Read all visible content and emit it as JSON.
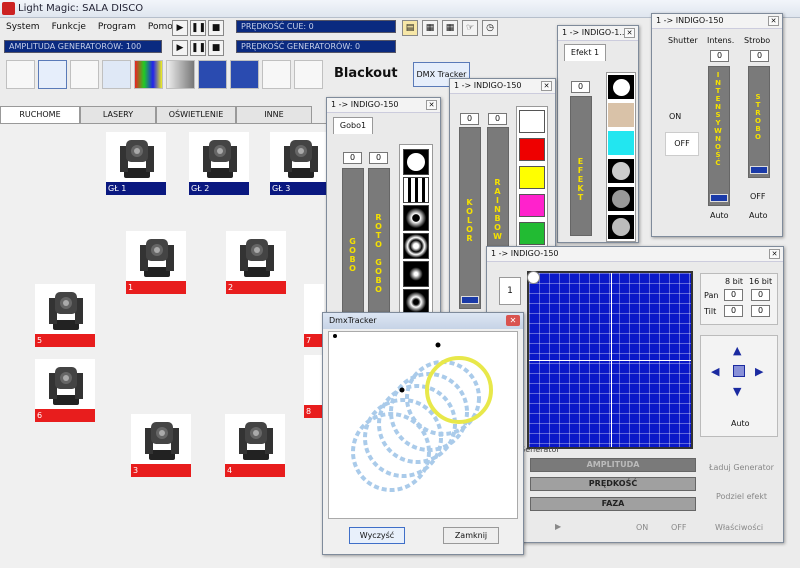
{
  "window": {
    "title": "Light Magic: SALA DISCO"
  },
  "menu": [
    "System",
    "Funkcje",
    "Program",
    "Pomoc"
  ],
  "toolbar": {
    "speed_label": "PRĘDKOŚĆ",
    "cue_label": "CUE: 0",
    "amp_label": "AMPLITUDA GENERATORÓW: 100",
    "gen_speed_label": "PRĘDKOŚĆ GENERATORÓW: 0",
    "blackout": "Blackout",
    "dmx_tracker": "DMX Tracker"
  },
  "tabs": [
    "RUCHOME GŁOWY",
    "LASERY",
    "OŚWIETLENIE LED",
    "INNE"
  ],
  "fixtures": {
    "top": [
      "GŁ 1",
      "GŁ 2",
      "GŁ 3"
    ],
    "rows": [
      "1",
      "2",
      "5",
      "7",
      "6",
      "8",
      "3",
      "4"
    ]
  },
  "gobo_window": {
    "title": "1 -> INDIGO-150",
    "tab": "Gobo1",
    "v1": "0",
    "v2": "0",
    "bar1": "GOBO",
    "bar2": "ROTO GOBO"
  },
  "kolor_window": {
    "title": "1 -> INDIGO-150",
    "v1": "0",
    "v2": "0",
    "bar1": "KOLOR",
    "bar2": "RAINBOW",
    "colors": [
      "#ffffff",
      "#ee0000",
      "#ffff00",
      "#ff22cc",
      "#22bb33"
    ]
  },
  "efekt_window": {
    "title": "1 -> INDIGO-1...",
    "tab": "Efekt 1",
    "v1": "0",
    "bar": "EFEKT"
  },
  "shutter_window": {
    "title": "1 -> INDIGO-150",
    "shutter": "Shutter",
    "intens": "Intens.",
    "strobo": "Strobo",
    "on": "ON",
    "off": "OFF",
    "v_int": "0",
    "v_str": "0",
    "bar_int": "INTENSYWNOŚĆ",
    "bar_str": "STROBO",
    "auto1": "Auto",
    "off2": "OFF",
    "auto2": "Auto"
  },
  "pantilt_window": {
    "title": "1 -> INDIGO-150",
    "num": "1",
    "bit8": "8 bit",
    "bit16": "16 bit",
    "pan": "Pan",
    "tilt": "Tilt",
    "pan8": "0",
    "pan16": "0",
    "tilt8": "0",
    "tilt16": "0",
    "auto": "Auto",
    "generator": "Generator",
    "amplituda": "AMPLITUDA",
    "predkosc": "PRĘDKOŚĆ",
    "faza": "FAZA",
    "laduj": "Ładuj Generator",
    "podziel": "Podziel efekt",
    "on": "ON",
    "off": "OFF",
    "wlasciwosci": "Właściwości"
  },
  "dmx_tracker": {
    "title": "DmxTracker",
    "clear": "Wyczyść",
    "close": "Zamknij"
  }
}
